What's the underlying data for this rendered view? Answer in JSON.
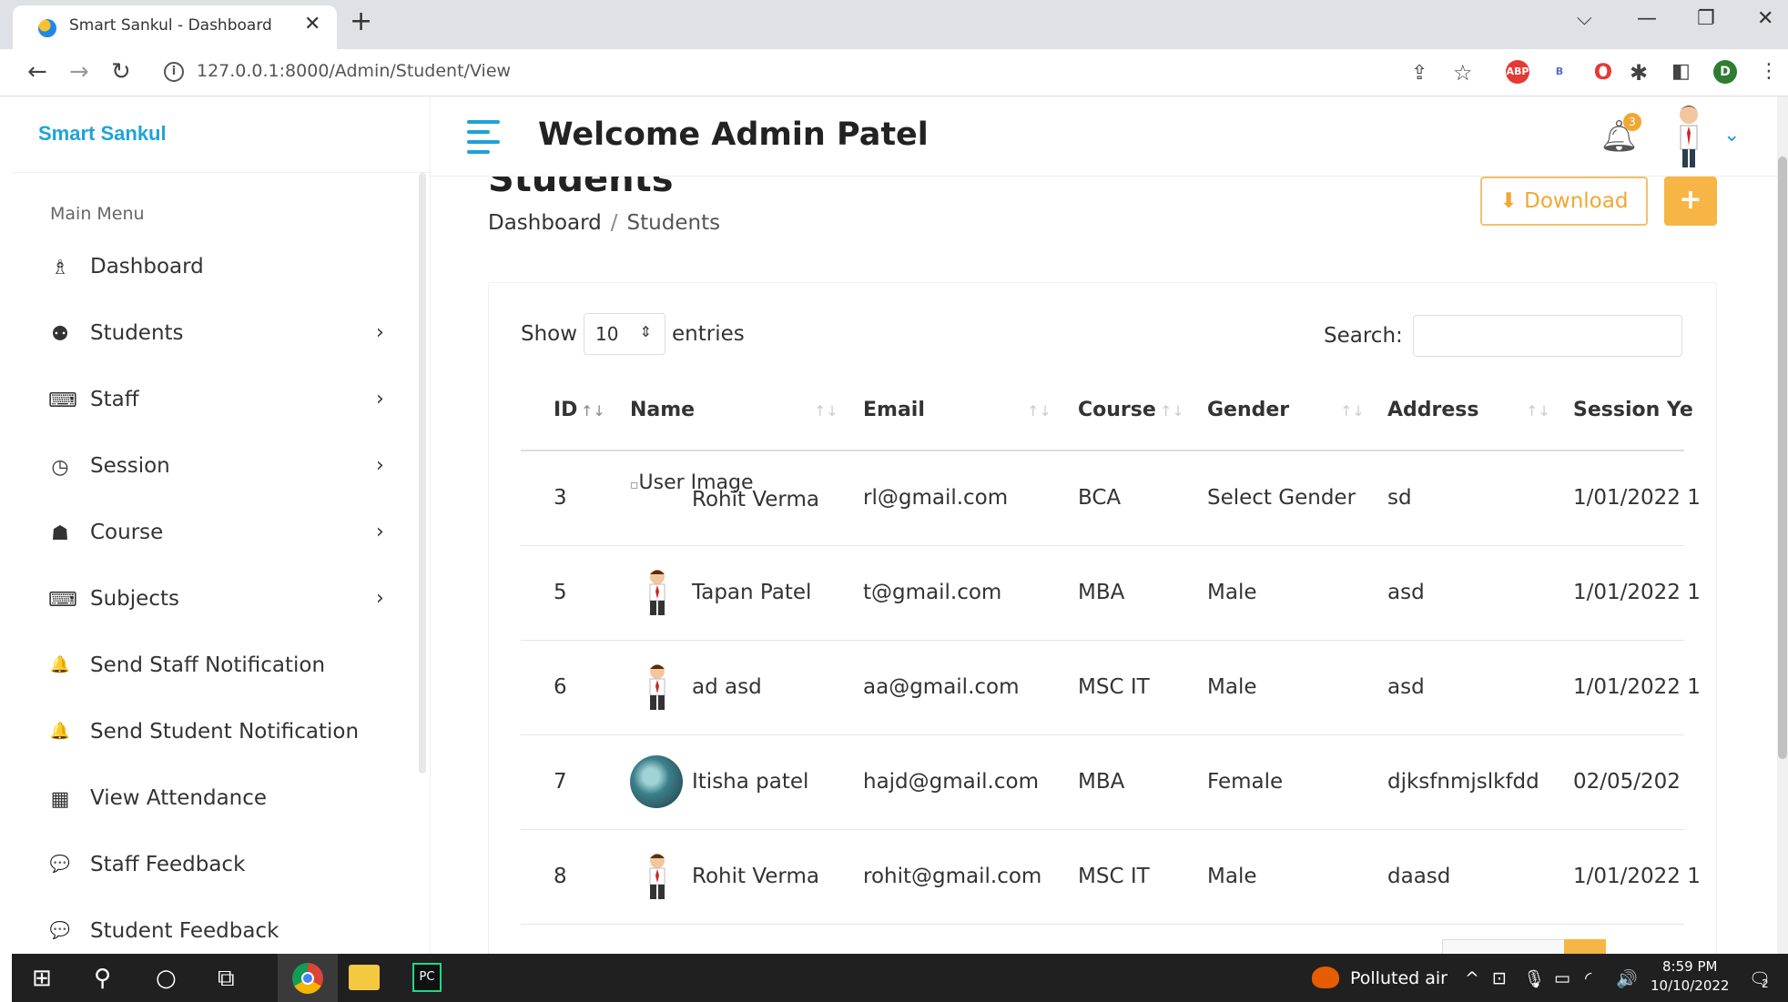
{
  "browser": {
    "tab_title": "Smart Sankul - Dashboard",
    "tab_close": "✕",
    "new_tab": "+",
    "url": "127.0.0.1:8000/Admin/Student/View",
    "window_controls": [
      "⌵",
      "—",
      "❐",
      "✕"
    ]
  },
  "sidebar": {
    "brand": "Smart Sankul",
    "menu_heading": "Main Menu",
    "items": [
      {
        "label": "Dashboard",
        "icon": "dashboard-icon",
        "glyph": "♗",
        "has_submenu": false
      },
      {
        "label": "Students",
        "icon": "students-icon",
        "glyph": "⚉",
        "has_submenu": true
      },
      {
        "label": "Staff",
        "icon": "staff-icon",
        "glyph": "⌨",
        "has_submenu": true
      },
      {
        "label": "Session",
        "icon": "clock-icon",
        "glyph": "◷",
        "has_submenu": true
      },
      {
        "label": "Course",
        "icon": "graduation-cap-icon",
        "glyph": "☗",
        "has_submenu": true
      },
      {
        "label": "Subjects",
        "icon": "subjects-icon",
        "glyph": "⌨",
        "has_submenu": true
      },
      {
        "label": "Send Staff Notification",
        "icon": "bell-icon",
        "glyph": "🔔",
        "has_submenu": false
      },
      {
        "label": "Send Student Notification",
        "icon": "bell-icon",
        "glyph": "🔔",
        "has_submenu": false
      },
      {
        "label": "View Attendance",
        "icon": "calendar-icon",
        "glyph": "▦",
        "has_submenu": false
      },
      {
        "label": "Staff Feedback",
        "icon": "comments-icon",
        "glyph": "💬",
        "has_submenu": false
      },
      {
        "label": "Student Feedback",
        "icon": "comments-icon",
        "glyph": "💬",
        "has_submenu": false
      }
    ],
    "chevron": "›"
  },
  "header": {
    "welcome": "Welcome  Admin Patel",
    "notification_count": "3"
  },
  "page": {
    "title": "Students",
    "breadcrumb_home": "Dashboard",
    "breadcrumb_sep": "/",
    "breadcrumb_current": "Students",
    "download_label": "Download",
    "add_label": "+"
  },
  "table": {
    "show_label": "Show",
    "page_size": "10",
    "entries_label": "entries",
    "search_label": "Search:",
    "search_value": "",
    "columns": [
      "ID",
      "Name",
      "Email",
      "Course",
      "Gender",
      "Address",
      "Session Ye"
    ],
    "broken_image_alt": "User Image",
    "rows": [
      {
        "id": "3",
        "name": "Rohit Verma",
        "email": "rl@gmail.com",
        "course": "BCA",
        "gender": "Select Gender",
        "address": "sd",
        "session": "1/01/2022 1",
        "photo": "broken"
      },
      {
        "id": "5",
        "name": "Tapan Patel",
        "email": "t@gmail.com",
        "course": "MBA",
        "gender": "Male",
        "address": "asd",
        "session": "1/01/2022 1",
        "photo": "cartoon"
      },
      {
        "id": "6",
        "name": "ad asd",
        "email": "aa@gmail.com",
        "course": "MSC IT",
        "gender": "Male",
        "address": "asd",
        "session": "1/01/2022 1",
        "photo": "cartoon"
      },
      {
        "id": "7",
        "name": "Itisha patel",
        "email": "hajd@gmail.com",
        "course": "MBA",
        "gender": "Female",
        "address": "djksfnmjslkfdd",
        "session": "02/05/202",
        "photo": "nature"
      },
      {
        "id": "8",
        "name": "Rohit Verma",
        "email": "rohit@gmail.com",
        "course": "MSC IT",
        "gender": "Male",
        "address": "daasd",
        "session": "1/01/2022 1",
        "photo": "cartoon"
      }
    ]
  },
  "taskbar": {
    "weather": "Polluted air",
    "time": "8:59 PM",
    "date": "10/10/2022",
    "notif_count": "2"
  },
  "colors": {
    "brand": "#1fa3d9",
    "accent_orange": "#f6b545",
    "taskbar": "#202020"
  }
}
